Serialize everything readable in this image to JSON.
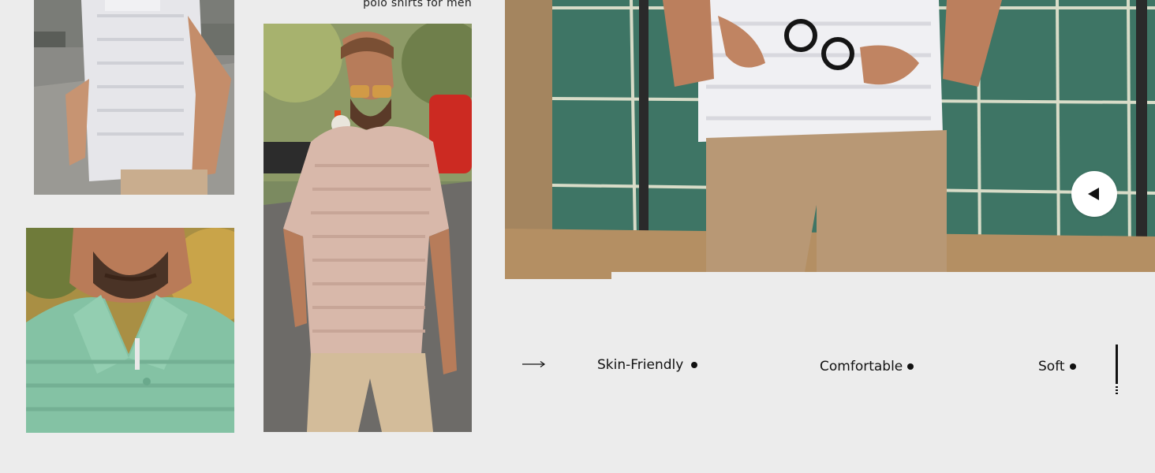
{
  "caption": "polo shirts for men",
  "photos": {
    "top_left": "man in white textured polo shirt walking, hand in pocket",
    "bottom_left": "close-up of man wearing sage green textured polo shirt",
    "center": "man in pink textured polo shirt and tan trousers walking on city street",
    "hero": "man in white textured polo holding sunglasses against green tiled wall"
  },
  "nav": {
    "prev_icon": "triangle-left-icon"
  },
  "features": [
    {
      "label": "Skin-Friendly"
    },
    {
      "label": "Comfortable"
    },
    {
      "label": "Soft"
    }
  ],
  "icons": {
    "arrow": "long-arrow-right-icon",
    "bullet": "dot-icon"
  },
  "colors": {
    "background": "#ececec",
    "text": "#111111",
    "tile_green": "#3f7567",
    "polo_pink": "#d6b6a8",
    "polo_green": "#7fbf9f"
  }
}
